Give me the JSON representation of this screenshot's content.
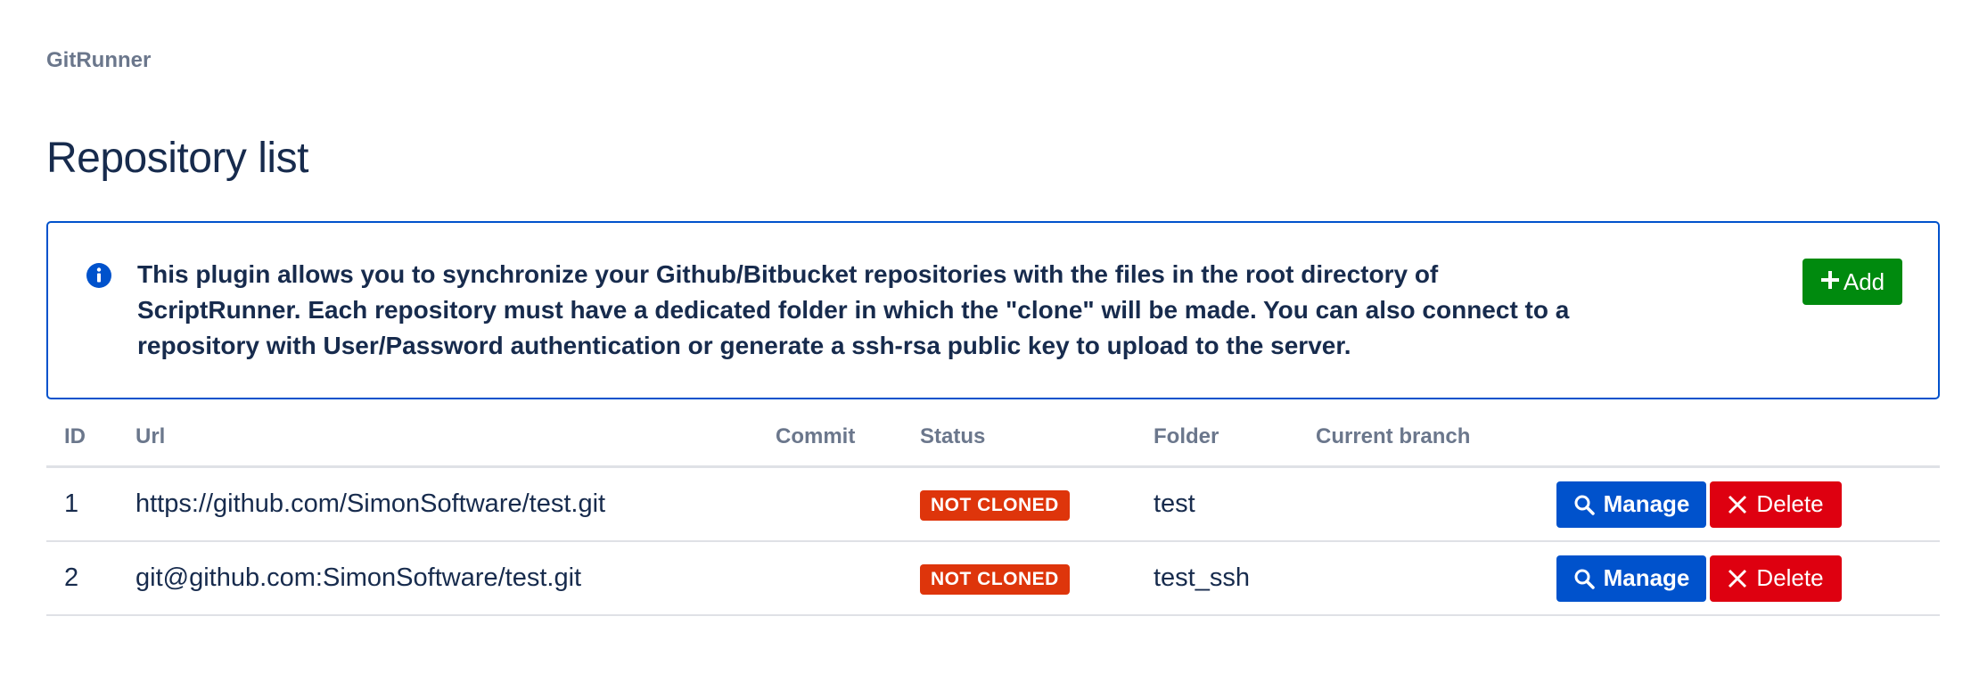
{
  "breadcrumb": "GitRunner",
  "page_title": "Repository list",
  "info_panel": {
    "text": "This plugin allows you to synchronize your Github/Bitbucket repositories with the files in the root directory of\nScriptRunner. Each repository must have a dedicated folder in which the \"clone\" will be made. You can also connect to a\nrepository with User/Password authentication or generate a ssh-rsa public key to upload to the server.",
    "add_label": "Add"
  },
  "table": {
    "headers": {
      "id": "ID",
      "url": "Url",
      "commit": "Commit",
      "status": "Status",
      "folder": "Folder",
      "branch": "Current branch"
    },
    "rows": [
      {
        "id": "1",
        "url": "https://github.com/SimonSoftware/test.git",
        "commit": "",
        "status": "NOT CLONED",
        "folder": "test",
        "branch": "",
        "manage_label": "Manage",
        "delete_label": "Delete"
      },
      {
        "id": "2",
        "url": "git@github.com:SimonSoftware/test.git",
        "commit": "",
        "status": "NOT CLONED",
        "folder": "test_ssh",
        "branch": "",
        "manage_label": "Manage",
        "delete_label": "Delete"
      }
    ]
  },
  "colors": {
    "primary": "#0052cc",
    "add_green": "#008a0e",
    "status_red": "#de350b",
    "delete_red": "#de0010",
    "heading": "#172b4d",
    "subtle": "#6b778c"
  },
  "icons": {
    "info": "info-icon",
    "add": "plus-icon",
    "manage": "search-icon",
    "delete": "close-icon"
  }
}
